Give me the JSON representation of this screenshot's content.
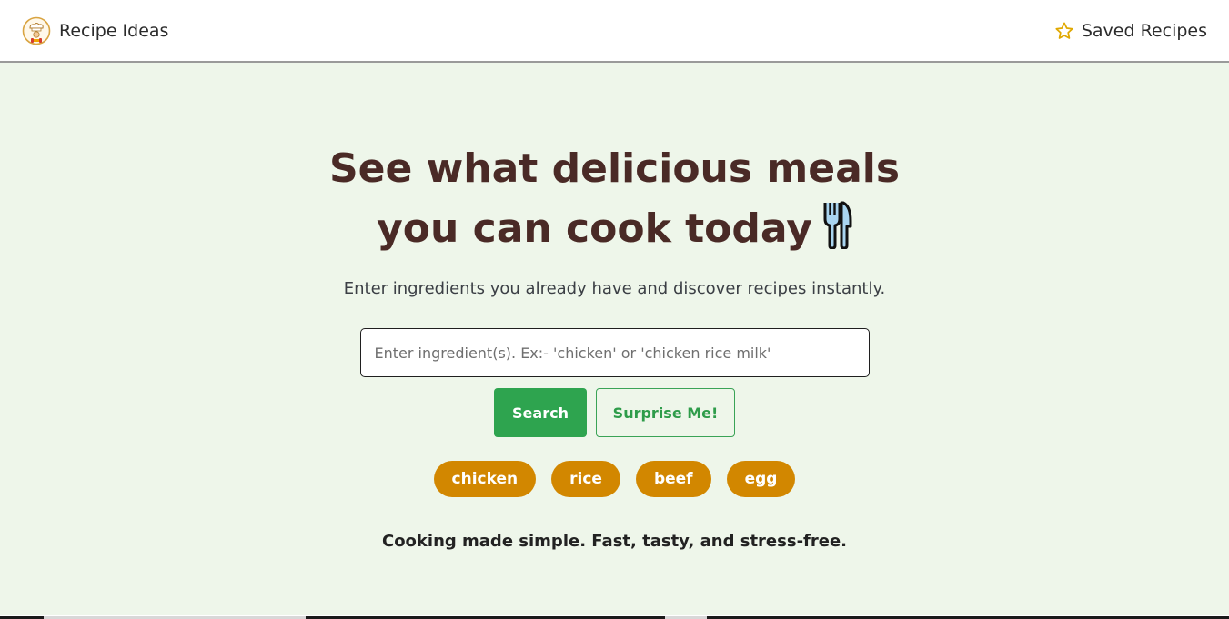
{
  "navbar": {
    "brand_name": "Recipe Ideas",
    "brand_logo_icon": "chef-logo-icon",
    "saved_label": "Saved Recipes",
    "saved_icon": "star-icon"
  },
  "hero": {
    "headline_line1": "See what delicious meals",
    "headline_line2": "you can cook today",
    "headline_icon": "fork-knife-icon",
    "subhead": "Enter ingredients you already have and discover recipes instantly.",
    "search": {
      "placeholder": "Enter ingredient(s). Ex:- 'chicken' or 'chicken rice milk'",
      "value": ""
    },
    "buttons": {
      "search_label": "Search",
      "surprise_label": "Surprise Me!"
    },
    "chips": [
      "chicken",
      "rice",
      "beef",
      "egg"
    ],
    "tagline": "Cooking made simple. Fast, tasty, and stress-free."
  },
  "colors": {
    "page_background": "#eef6ea",
    "headline": "#4a2a26",
    "primary_button": "#2ea44f",
    "chip": "#d28700",
    "star": "#e0a800"
  }
}
